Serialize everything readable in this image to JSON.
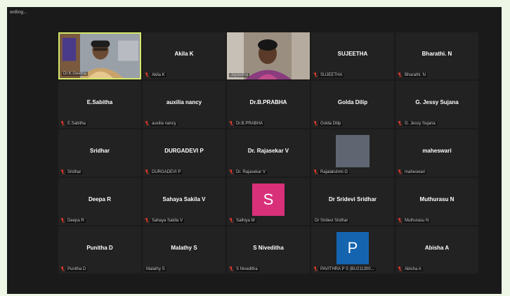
{
  "window": {
    "recording_label": "ording..."
  },
  "colors": {
    "active_border": "#d3e86b",
    "mute_icon": "#e33b2f",
    "avatar_s": "#d9307a",
    "avatar_p": "#1564b0"
  },
  "tiles": [
    {
      "type": "video",
      "label": "Dr.K.Geetha",
      "muted": false,
      "active": true,
      "video": "woman-office"
    },
    {
      "type": "name",
      "name": "Akila K",
      "label": "Akila K",
      "muted": true
    },
    {
      "type": "video",
      "label": "Jayasima",
      "muted": false,
      "video": "woman-room"
    },
    {
      "type": "name",
      "name": "SUJEETHA",
      "label": "SUJEETHA",
      "muted": true
    },
    {
      "type": "name",
      "name": "Bharathi. N",
      "label": "Bharathi. N",
      "muted": true
    },
    {
      "type": "name",
      "name": "E.Sabitha",
      "label": "E.Sabitha",
      "muted": true
    },
    {
      "type": "name",
      "name": "auxilia nancy",
      "label": "auxilia nancy",
      "muted": true
    },
    {
      "type": "name",
      "name": "Dr.B.PRABHA",
      "label": "Dr.B.PRABHA",
      "muted": true
    },
    {
      "type": "name",
      "name": "Golda Dilip",
      "label": "Golda Dilip",
      "muted": true
    },
    {
      "type": "name",
      "name": "G. Jessy Sujana",
      "label": "G. Jessy Sujana",
      "muted": true
    },
    {
      "type": "name",
      "name": "Sridhar",
      "label": "Sridhar",
      "muted": true
    },
    {
      "type": "name",
      "name": "DURGADEVI P",
      "label": "DURGADEVI P",
      "muted": true
    },
    {
      "type": "name",
      "name": "Dr. Rajasekar V",
      "label": "Dr. Rajasekar V",
      "muted": true
    },
    {
      "type": "photo",
      "label": "Rajalakshmi G",
      "muted": true
    },
    {
      "type": "name",
      "name": "maheswari",
      "label": "maheswari",
      "muted": true
    },
    {
      "type": "name",
      "name": "Deepa R",
      "label": "Deepa R",
      "muted": true
    },
    {
      "type": "name",
      "name": "Sahaya Sakila V",
      "label": "Sahaya Sakila V",
      "muted": true
    },
    {
      "type": "letter",
      "letter": "S",
      "color": "#d9307a",
      "label": "Sathiya M",
      "muted": true
    },
    {
      "type": "name",
      "name": "Dr Sridevi Sridhar",
      "label": "Dr Sridevi Sridhar",
      "muted": false
    },
    {
      "type": "name",
      "name": "Muthurasu N",
      "label": "Muthurasu N",
      "muted": true
    },
    {
      "type": "name",
      "name": "Punitha D",
      "label": "Punitha D",
      "muted": true
    },
    {
      "type": "name",
      "name": "Malathy S",
      "label": "Malathy S",
      "muted": false
    },
    {
      "type": "name",
      "name": "S Niveditha",
      "label": "S Niveditha",
      "muted": true
    },
    {
      "type": "letter",
      "letter": "P",
      "color": "#1564b0",
      "label": "PAVITHRA P S (BU211300...",
      "muted": true
    },
    {
      "type": "name",
      "name": "Abisha A",
      "label": "Abisha A",
      "muted": true
    }
  ]
}
